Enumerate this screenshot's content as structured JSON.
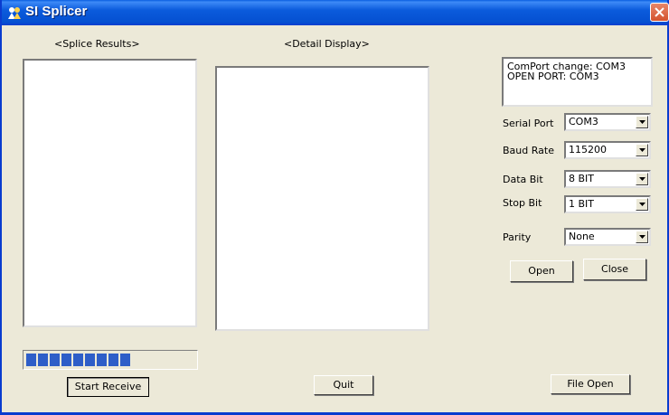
{
  "window": {
    "title": "SI Splicer"
  },
  "headers": {
    "results": "<Splice Results>",
    "detail": "<Detail Display>"
  },
  "status_lines": [
    "ComPort change: COM3",
    "OPEN PORT: COM3"
  ],
  "settings": [
    {
      "label": "Serial Port",
      "value": "COM3"
    },
    {
      "label": "Baud Rate",
      "value": "115200"
    },
    {
      "label": "Data Bit",
      "value": "8 BIT"
    },
    {
      "label": "Stop Bit",
      "value": "1 BIT"
    },
    {
      "label": "Parity",
      "value": "None"
    }
  ],
  "buttons": {
    "open": "Open",
    "close": "Close",
    "start_receive": "Start Receive",
    "quit": "Quit",
    "file_open": "File Open"
  },
  "progress": {
    "filled_segments": 9,
    "total_segments": 15
  },
  "colors": {
    "titlebar": "#0550d1",
    "progress": "#2e5ec8",
    "face": "#ece9d8"
  }
}
